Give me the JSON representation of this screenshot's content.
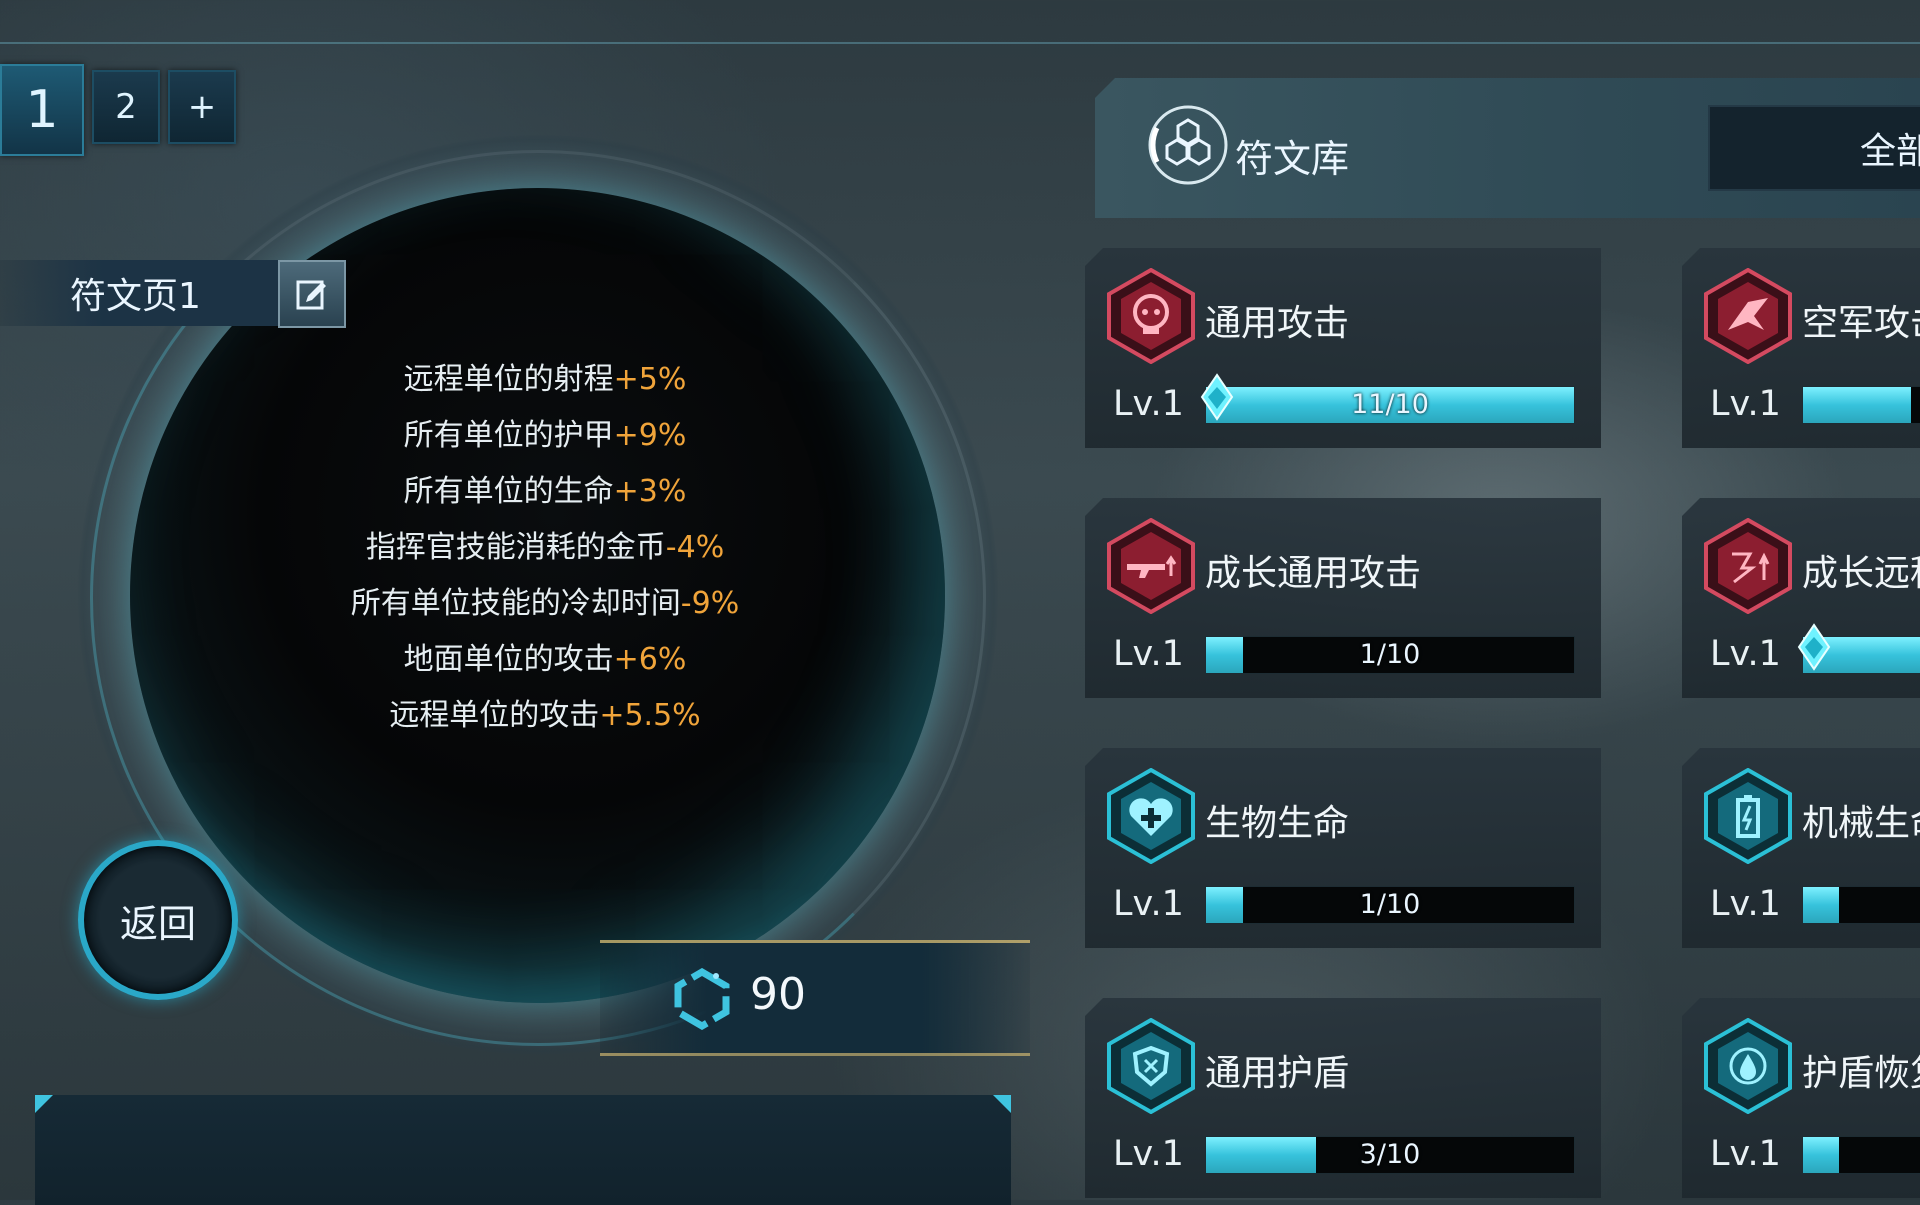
{
  "page_tabs": [
    {
      "label": "1",
      "active": true
    },
    {
      "label": "2",
      "active": false
    },
    {
      "label": "+",
      "active": false
    }
  ],
  "rune_page": {
    "name": "符文页1",
    "bonuses": [
      {
        "text": "远程单位的射程",
        "value": "+5%"
      },
      {
        "text": "所有单位的护甲",
        "value": "+9%"
      },
      {
        "text": "所有单位的生命",
        "value": "+3%"
      },
      {
        "text": "指挥官技能消耗的金币",
        "value": "-4%"
      },
      {
        "text": "所有单位技能的冷却时间",
        "value": "-9%"
      },
      {
        "text": "地面单位的攻击",
        "value": "+6%"
      },
      {
        "text": "远程单位的攻击",
        "value": "+5.5%"
      }
    ]
  },
  "back_button": {
    "label": "返回"
  },
  "points": {
    "value": "90"
  },
  "library": {
    "title": "符文库",
    "filter_label": "全部",
    "runes": [
      {
        "name": "通用攻击",
        "level": "Lv.1",
        "progress_text": "11/10",
        "progress": 1.0,
        "maxed": true,
        "type": "attack",
        "icon": "skull-icon"
      },
      {
        "name": "空军攻击",
        "level": "Lv.1",
        "progress_text": "",
        "progress": 0.95,
        "maxed": false,
        "type": "attack",
        "icon": "aircraft-icon"
      },
      {
        "name": "成长通用攻击",
        "level": "Lv.1",
        "progress_text": "1/10",
        "progress": 0.1,
        "maxed": false,
        "type": "attack",
        "icon": "rifle-icon"
      },
      {
        "name": "成长远程",
        "level": "Lv.1",
        "progress_text": "",
        "progress": 1.0,
        "maxed": true,
        "type": "attack",
        "icon": "ranged-icon"
      },
      {
        "name": "生物生命",
        "level": "Lv.1",
        "progress_text": "1/10",
        "progress": 0.1,
        "maxed": false,
        "type": "defense",
        "icon": "heart-plus-icon"
      },
      {
        "name": "机械生命",
        "level": "Lv.1",
        "progress_text": "",
        "progress": 0.1,
        "maxed": false,
        "type": "defense",
        "icon": "battery-icon"
      },
      {
        "name": "通用护盾",
        "level": "Lv.1",
        "progress_text": "3/10",
        "progress": 0.3,
        "maxed": false,
        "type": "defense",
        "icon": "shield-icon"
      },
      {
        "name": "护盾恢复",
        "level": "Lv.1",
        "progress_text": "",
        "progress": 0.1,
        "maxed": false,
        "type": "defense",
        "icon": "drop-icon"
      }
    ]
  },
  "colors": {
    "accent": "#37c3dc",
    "bonus_value": "#f0a43a",
    "attack_icon": "#c8344a",
    "defense_icon": "#2bc0d6"
  }
}
